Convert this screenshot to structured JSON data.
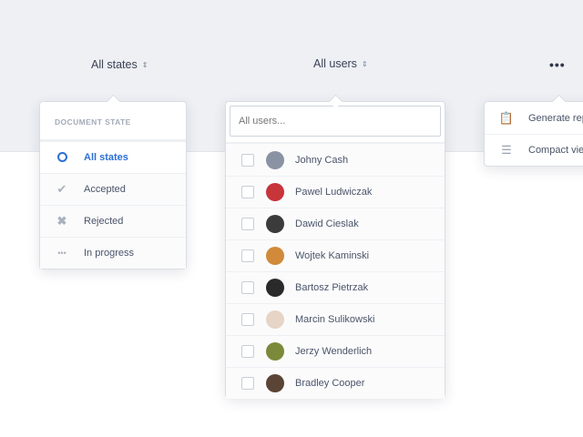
{
  "filters": {
    "states_label": "All states",
    "users_label": "All users",
    "sort_glyph": "⇕",
    "more_glyph": "•••"
  },
  "states": {
    "heading": "DOCUMENT STATE",
    "items": [
      {
        "label": "All states",
        "icon": "circle-icon",
        "selected": true
      },
      {
        "label": "Accepted",
        "icon": "check-icon"
      },
      {
        "label": "Rejected",
        "icon": "x-icon"
      },
      {
        "label": "In progress",
        "icon": "progress-dots-icon"
      }
    ]
  },
  "users": {
    "search_placeholder": "All users...",
    "items": [
      {
        "name": "Johny Cash",
        "color": "#8a93a3"
      },
      {
        "name": "Pawel Ludwiczak",
        "color": "#c7343a"
      },
      {
        "name": "Dawid Cieslak",
        "color": "#3b3b3b"
      },
      {
        "name": "Wojtek Kaminski",
        "color": "#d08a3a"
      },
      {
        "name": "Bartosz Pietrzak",
        "color": "#2a2a2a"
      },
      {
        "name": "Marcin Sulikowski",
        "color": "#e6d4c6"
      },
      {
        "name": "Jerzy Wenderlich",
        "color": "#7a8a3a"
      },
      {
        "name": "Bradley Cooper",
        "color": "#5a4436"
      }
    ]
  },
  "more": {
    "items": [
      {
        "label": "Generate rep",
        "icon": "report-icon"
      },
      {
        "label": "Compact vie",
        "icon": "list-icon"
      }
    ]
  }
}
